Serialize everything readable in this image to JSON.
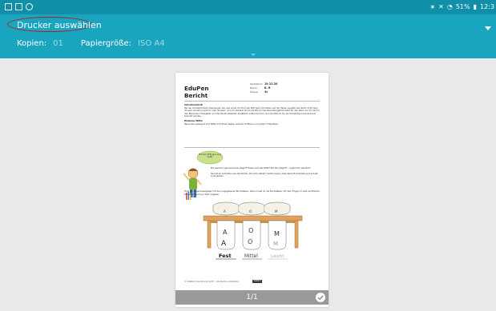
{
  "status": {
    "right_text": "51%",
    "time": "12:3"
  },
  "header": {
    "printer_label": "Drucker auswählen",
    "copies_label": "Kopien:",
    "copies_value": "01",
    "paper_label": "Papiergröße:",
    "paper_value": "ISO A4"
  },
  "document": {
    "title_line1": "EduPen",
    "title_line2": "Bericht",
    "meta": [
      {
        "label": "Testdatum",
        "value": "19.12.20"
      },
      {
        "label": "Name",
        "value": "K. R"
      },
      {
        "label": "Klasse",
        "value": "3c"
      }
    ],
    "section1_heading": "Schreibmotorik:",
    "section1_text": "Bei der Schreibmotorik überzeugen Sie, wie sicher Ihr Kind den Stift beim Schreiben auf der Papier ansetzt, bei leicht nicht klein, ob sehr schnell (unschön) oder langsam und mit starkem Druck (Kraft) ist. Das Gesamtergebnis steht für den Wert, der ihr Kind in den Bereichen Flüssigkeit und Handkraft abwertet. Zusätzlich sollte die Form und die Motorik für die Schreibhand ausreichend trainiert werden.",
    "section2_heading": "Hinweise Stifte:",
    "section2_text": "Besonders geeignet sind Stifte mit dicker Spitze, welcher Griffzone und gutem Tintenfluss.",
    "speech_bubble": "Mit dem Stift ganz lang Kraft!",
    "exercise_text1": "Mit welchem gemeinsamen Begriff finden sich die Stifte? Mit dem Begriff... ergibt sich das Wort.",
    "exercise_text2": "Kannst du schreiben wie die Wörter, die links stehen? Achte darauf, dass deine Buchstaben gut auf der Linie stehen.",
    "instruction": "Fülle die Regenmessgläser mit den angegebenen Buchstaben. Dazu musst du die Buchstaben mit dem Finger im Glas nachfahren. Das wird gleich ein Wort ergeben.",
    "lid_letters": [
      "A",
      "O",
      "M"
    ],
    "jar_letters_upper": [
      "A",
      "O",
      "M"
    ],
    "jar_letters_lower": [
      "A",
      "O",
      "M"
    ],
    "words": [
      "Fest",
      "Mittel",
      "Leicht"
    ],
    "footer_left": "© STABILO International GmbH · Alle Rechte vorbehalten",
    "footer_logo": "STABILO"
  },
  "page_indicator": "1/1",
  "colors": {
    "header": "#19a5c0",
    "status_bar": "#0f8fa8",
    "highlight_oval": "#b02020",
    "background": "#e9e9e9"
  },
  "icons": [
    "image-icon",
    "mail-icon",
    "settings-icon",
    "bluetooth-icon",
    "mute-icon",
    "wifi-icon",
    "battery-icon",
    "dropdown-icon",
    "expand-icon",
    "check-icon"
  ]
}
